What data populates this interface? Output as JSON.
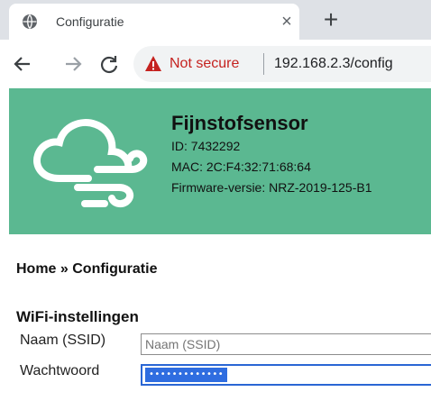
{
  "browser": {
    "tab": {
      "title": "Configuratie",
      "close_glyph": "×"
    },
    "new_tab_glyph": "+",
    "security_label": "Not secure",
    "url": "192.168.2.3/config",
    "icons": [
      "globe-icon",
      "back-arrow-icon",
      "forward-arrow-icon",
      "reload-icon",
      "warning-icon"
    ],
    "colors": {
      "not_secure": "#c5221f"
    }
  },
  "page": {
    "header": {
      "title": "Fijnstofsensor",
      "id_line": "ID: 7432292",
      "mac_line": "MAC: 2C:F4:32:71:68:64",
      "firmware_line": "Firmware-versie: NRZ-2019-125-B1",
      "logo_icon": "cloud-wind-icon",
      "background_color": "#5bb891"
    },
    "breadcrumb": "Home » Configuratie",
    "wifi": {
      "section_title": "WiFi-instellingen",
      "ssid_label": "Naam (SSID)",
      "ssid_placeholder": "Naam (SSID)",
      "password_label": "Wachtwoord",
      "password_mask": "•••••••••••••"
    }
  }
}
